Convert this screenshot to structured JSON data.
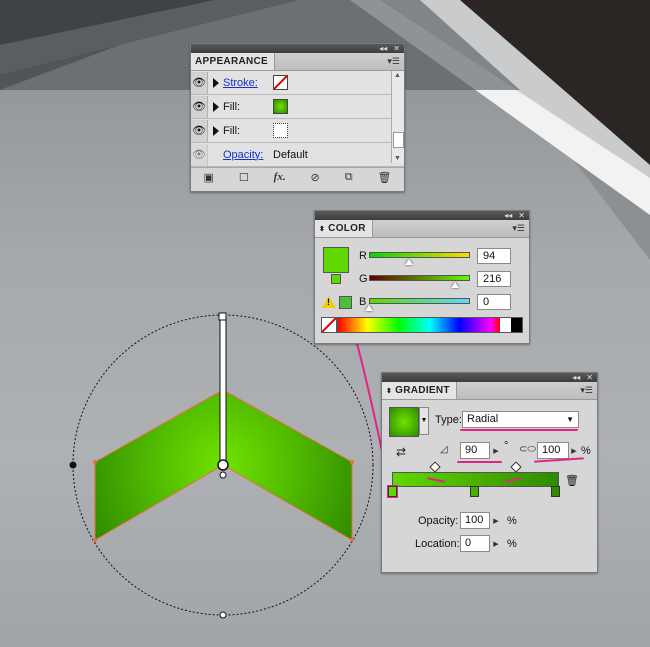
{
  "appearance": {
    "title": "APPEARANCE",
    "rows": [
      {
        "label": "Stroke:",
        "link": true,
        "swatch": "none"
      },
      {
        "label": "Fill:",
        "link": false,
        "swatch": "green"
      },
      {
        "label": "Fill:",
        "link": false,
        "swatch": "dotted"
      },
      {
        "label": "Opacity:",
        "link": true,
        "value": "Default"
      }
    ],
    "footer_icons": [
      "new-art-icon",
      "clear-icon",
      "fx-icon",
      "clear-appearance-icon",
      "duplicate-icon",
      "trash-icon"
    ],
    "fx_label": "fx."
  },
  "color": {
    "title": "COLOR",
    "r_label": "R",
    "g_label": "G",
    "b_label": "B",
    "r": "94",
    "g": "216",
    "b": "0",
    "fill_hex": "#5ed800",
    "r_fraction": 0.37,
    "g_fraction": 0.85,
    "b_fraction": 0.0
  },
  "gradient": {
    "title": "GRADIENT",
    "type_label": "Type:",
    "type_value": "Radial",
    "angle_value": "90",
    "degree_symbol": "°",
    "aspect_value": "100",
    "aspect_unit": "%",
    "opacity_label": "Opacity:",
    "opacity_value": "100",
    "opacity_unit": "%",
    "location_label": "Location:",
    "location_value": "0",
    "location_unit": "%"
  },
  "colors": {
    "accent_pink": "#e0248c",
    "shape_green": "#5ed800",
    "shape_outline": "#e8703a"
  }
}
